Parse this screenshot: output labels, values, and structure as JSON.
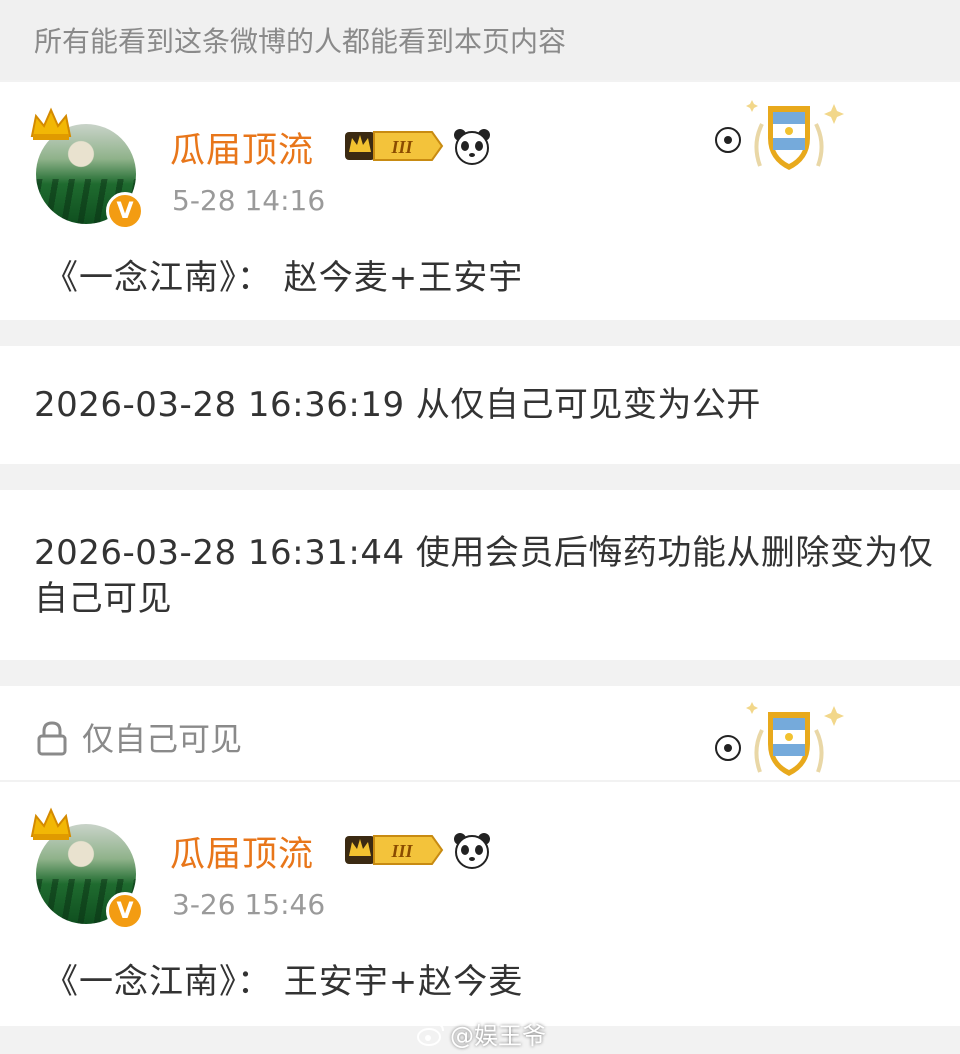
{
  "visibility_notice": "所有能看到这条微博的人都能看到本页内容",
  "posts": [
    {
      "username": "瓜届顶流",
      "member_level": "III",
      "time": "5-28 14:16",
      "text": "《一念江南》： 赵今麦+王安宇"
    },
    {
      "username": "瓜届顶流",
      "member_level": "III",
      "time": "3-26 15:46",
      "text": "《一念江南》： 王安宇+赵今麦"
    }
  ],
  "logs": [
    {
      "text": "2026-03-28 16:36:19 从仅自己可见变为公开"
    },
    {
      "text": "2026-03-28 16:31:44 使用会员后悔药功能从删除变为仅自己可见"
    }
  ],
  "private_label": "仅自己可见",
  "watermark": "@娱王爷",
  "colors": {
    "username": "#e8761a",
    "badge_gold": "#f0b429",
    "verified": "#f39c12",
    "muted_text": "#8a8a8a",
    "background": "#f2f2f2"
  },
  "icons": {
    "crown": "crown-icon",
    "verified": "verified-badge-icon",
    "panda": "panda-icon",
    "fan_badge": "argentina-football-fan-badge-icon",
    "lock": "lock-icon"
  }
}
